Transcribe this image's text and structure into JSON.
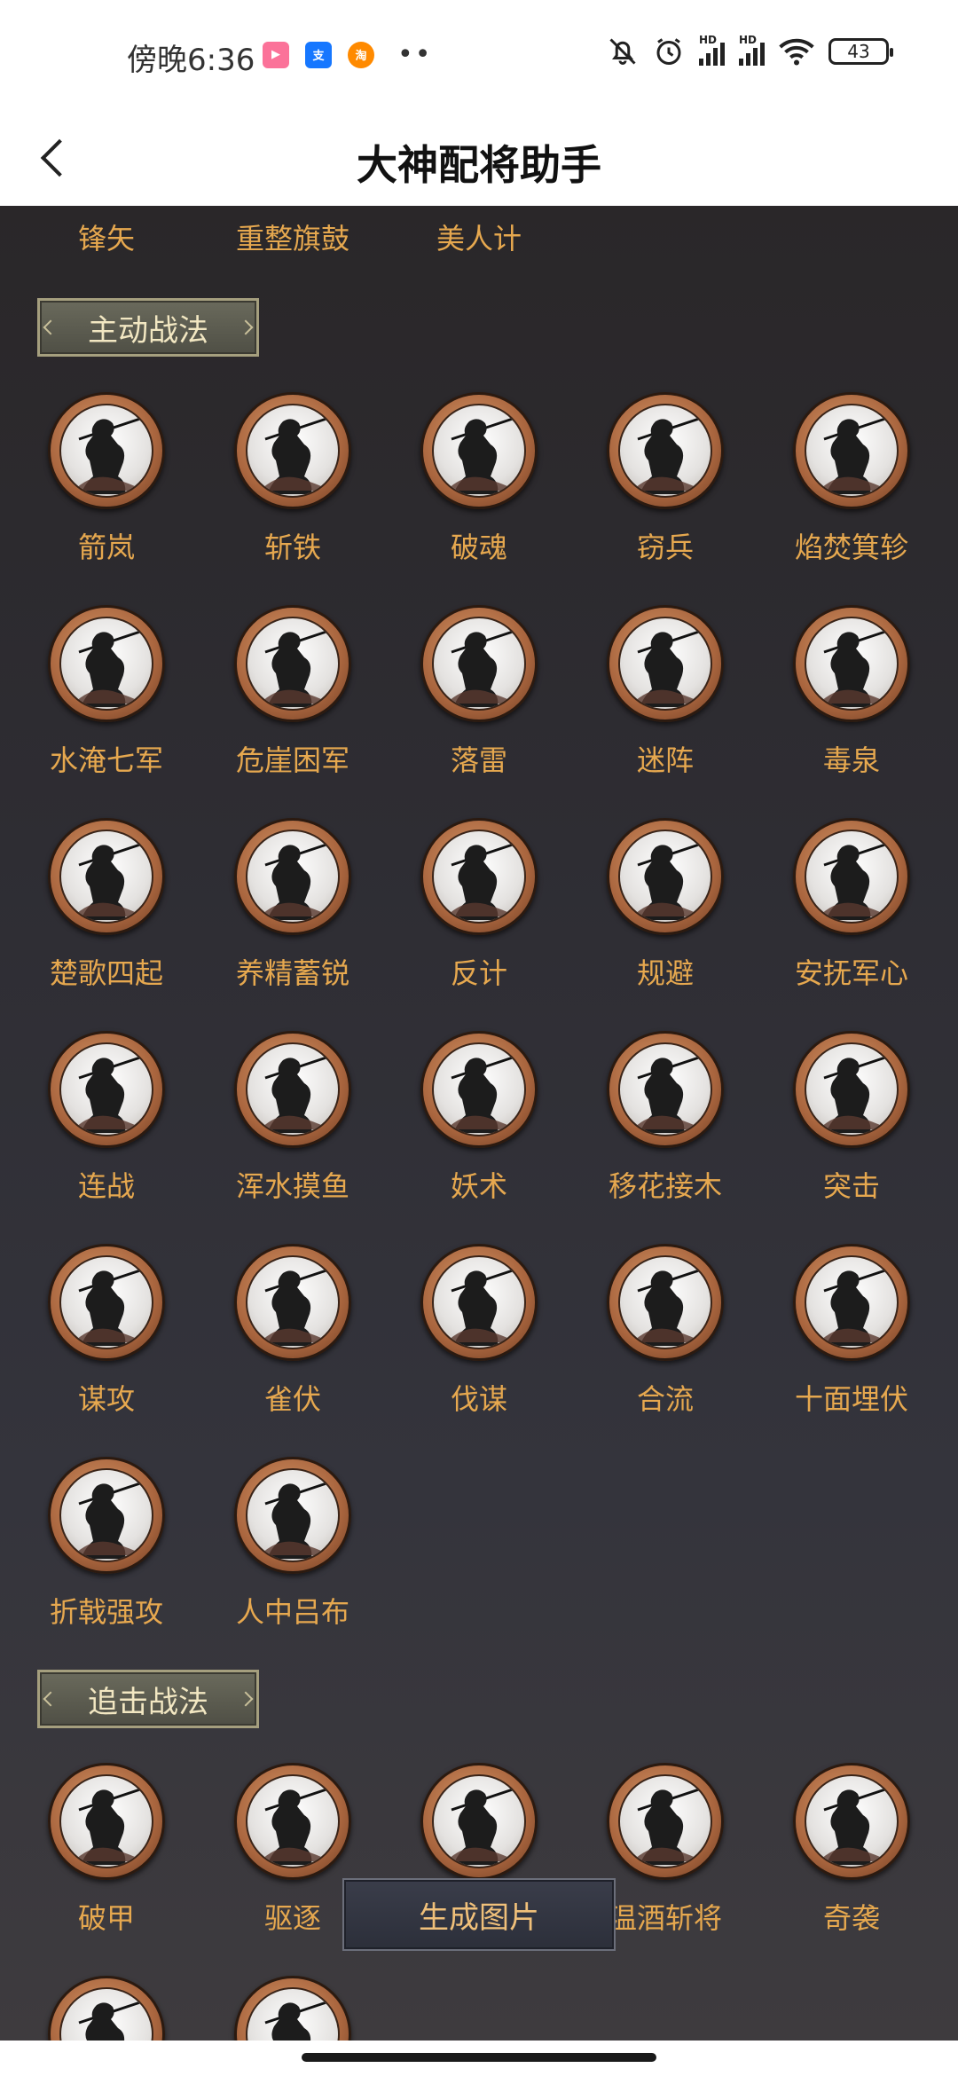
{
  "status_bar": {
    "time": "傍晚6:36",
    "app_icons": [
      {
        "name": "bilibili-icon",
        "color": "#fb7299",
        "glyph": "▶"
      },
      {
        "name": "alipay-icon",
        "color": "#1677ff",
        "glyph": "支"
      },
      {
        "name": "taobao-icon",
        "color": "#ff8a00",
        "glyph": "淘"
      }
    ],
    "more_dots": "••",
    "hd_label": "HD",
    "battery": "43"
  },
  "header": {
    "title": "大神配将助手"
  },
  "top_row": [
    "锋矢",
    "重整旗鼓",
    "美人计"
  ],
  "sections": [
    {
      "title": "主动战法",
      "skills": [
        "箭岚",
        "斩铁",
        "破魂",
        "窃兵",
        "焰焚箕轸",
        "水淹七军",
        "危崖困军",
        "落雷",
        "迷阵",
        "毒泉",
        "楚歌四起",
        "养精蓄锐",
        "反计",
        "规避",
        "安抚军心",
        "连战",
        "浑水摸鱼",
        "妖术",
        "移花接木",
        "突击",
        "谋攻",
        "雀伏",
        "伐谋",
        "合流",
        "十面埋伏",
        "折戟强攻",
        "人中吕布"
      ]
    },
    {
      "title": "追击战法",
      "skills": [
        "破甲",
        "驱逐",
        "",
        "温酒斩将",
        "奇袭",
        "",
        ""
      ]
    }
  ],
  "generate_button": "生成图片",
  "colors": {
    "accent_text": "#e6a84f",
    "background": "#2e2d33"
  }
}
